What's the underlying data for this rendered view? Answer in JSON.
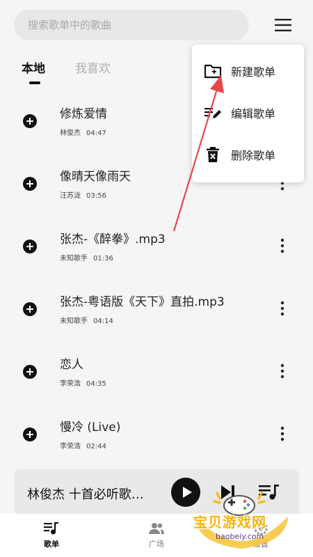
{
  "search": {
    "placeholder": "搜索歌单中的歌曲"
  },
  "header": {
    "menu_icon": "hamburger-menu-icon"
  },
  "tabs": [
    {
      "label": "本地",
      "active": true
    },
    {
      "label": "我喜欢",
      "active": false
    }
  ],
  "songs": [
    {
      "title": "修炼爱情",
      "artist": "林俊杰",
      "duration": "04:47"
    },
    {
      "title": "像晴天像雨天",
      "artist": "汪苏泷",
      "duration": "03:56"
    },
    {
      "title": "张杰-《醉拳》.mp3",
      "artist": "未知歌手",
      "duration": "01:36"
    },
    {
      "title": "张杰-粤语版《天下》直拍.mp3",
      "artist": "未知歌手",
      "duration": "04:14"
    },
    {
      "title": "恋人",
      "artist": "李荣浩",
      "duration": "04:35"
    },
    {
      "title": "慢冷 (Live)",
      "artist": "李荣浩",
      "duration": "02:44"
    }
  ],
  "dropdown_menu": [
    {
      "label": "新建歌单",
      "icon": "new-folder-icon"
    },
    {
      "label": "编辑歌单",
      "icon": "edit-list-icon"
    },
    {
      "label": "删除歌单",
      "icon": "trash-icon"
    }
  ],
  "annotation": {
    "arrow_color": "#e8474a"
  },
  "player": {
    "now_playing": "林俊杰 十首必听歌…",
    "play_icon": "play-icon",
    "next_icon": "skip-next-icon",
    "queue_icon": "queue-music-icon"
  },
  "bottom_nav": [
    {
      "label": "歌单",
      "icon": "playlist-icon",
      "active": true
    },
    {
      "label": "广场",
      "icon": "people-icon",
      "active": false
    },
    {
      "label": "设置",
      "icon": "settings-icon",
      "active": false
    }
  ],
  "watermark": {
    "text": "宝贝游戏网",
    "url": "baobeiy.com"
  },
  "colors": {
    "accent": "#111111",
    "background": "#f5f5f5",
    "watermark": "#f6b40e"
  }
}
